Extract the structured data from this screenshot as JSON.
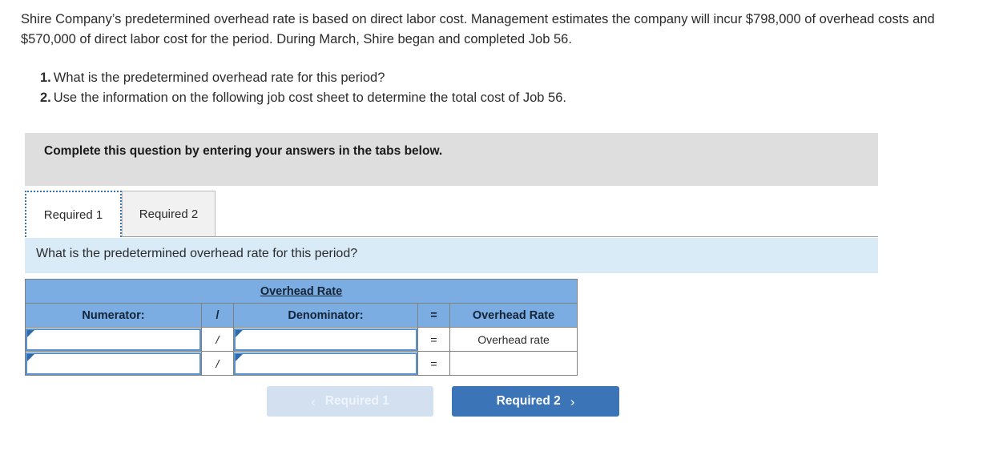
{
  "problem": {
    "stem": "Shire Company’s predetermined overhead rate is based on direct labor cost. Management estimates the company will incur $798,000 of overhead costs and $570,000 of direct labor cost for the period. During March, Shire began and completed Job 56.",
    "requirements": [
      {
        "number": "1.",
        "text": "What is the predetermined overhead rate for this period?"
      },
      {
        "number": "2.",
        "text": "Use the information on the following job cost sheet to determine the total cost of Job 56."
      }
    ]
  },
  "instruction_banner": {
    "text": "Complete this question by entering your answers in the tabs below."
  },
  "tabs": [
    {
      "label": "Required 1",
      "active": true
    },
    {
      "label": "Required 2",
      "active": false
    }
  ],
  "question_bar": {
    "text": "What is the predetermined overhead rate for this period?"
  },
  "table": {
    "title": "Overhead Rate",
    "headers": {
      "numerator": "Numerator:",
      "slash": "/",
      "denominator": "Denominator:",
      "equals": "=",
      "rate": "Overhead Rate"
    },
    "rows": [
      {
        "numerator_value": "",
        "slash": "/",
        "denominator_value": "",
        "equals": "=",
        "result": "Overhead rate"
      },
      {
        "numerator_value": "",
        "slash": "/",
        "denominator_value": "",
        "equals": "=",
        "result": ""
      }
    ]
  },
  "nav": {
    "prev_label": "Required 1",
    "prev_icon": "chevron-left-icon",
    "prev_glyph": "‹",
    "next_label": "Required 2",
    "next_icon": "chevron-right-icon",
    "next_glyph": "›"
  },
  "colors": {
    "banner_gray": "#dedede",
    "question_blue": "#daebf8",
    "table_header_blue": "#7BADE2",
    "button_blue": "#3b75b8",
    "button_disabled": "#d3e0f0",
    "input_border": "#5b93ce"
  }
}
